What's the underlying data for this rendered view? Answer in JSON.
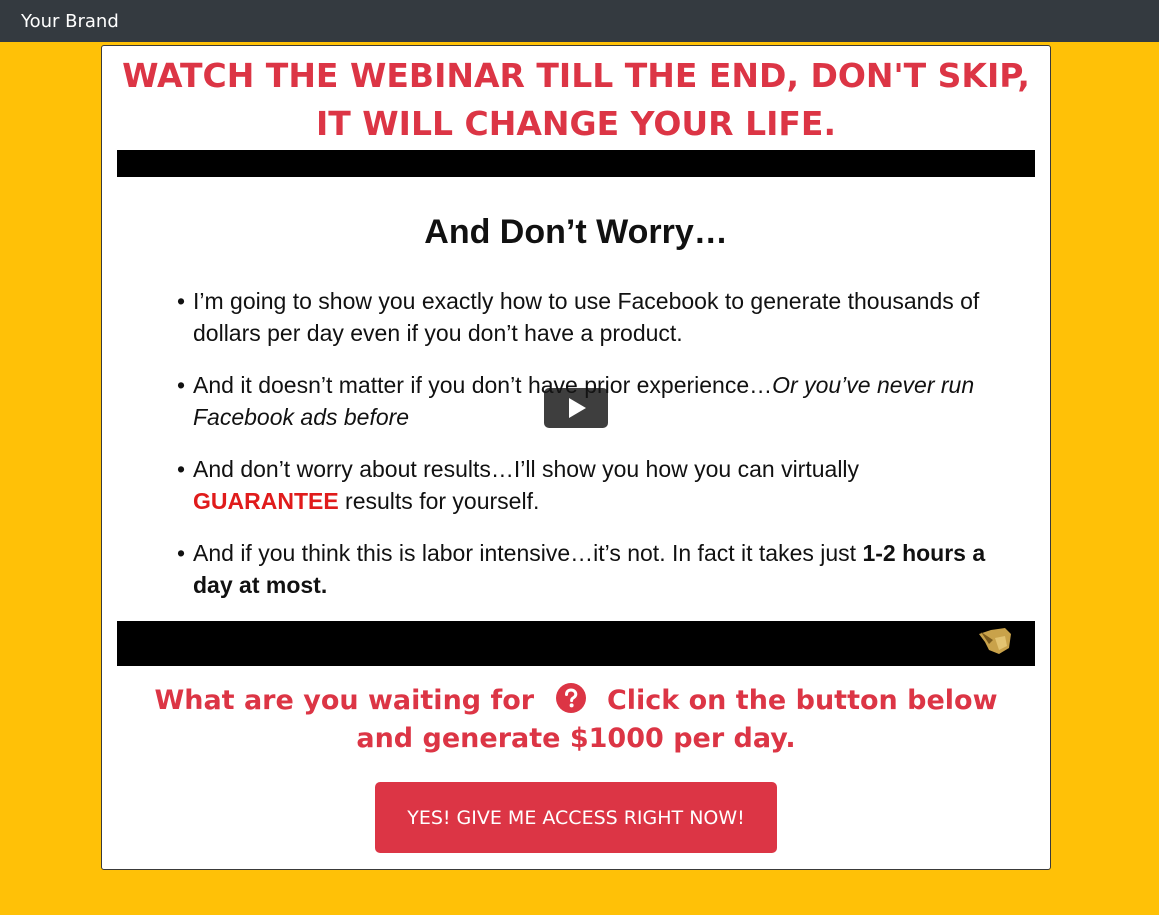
{
  "navbar": {
    "brand": "Your Brand"
  },
  "headline": "WATCH THE WEBINAR TILL THE END, DON'T SKIP, IT WILL CHANGE YOUR LIFE.",
  "video": {
    "slide_title": "And Don’t Worry…",
    "bullets": {
      "b1": "I’m going to show you exactly how to use Facebook to generate thousands of dollars per day even if you don’t have a product.",
      "b2_normal": "And it doesn’t matter if you don’t have prior experience…",
      "b2_italic": "Or you’ve never run Facebook ads before",
      "b3_start": "And don’t worry about results…I’ll show you how you can virtually ",
      "b3_highlight": "GUARANTEE",
      "b3_end": " results for yourself.",
      "b4_normal": "And if you think this is labor intensive…it’s not. In fact it takes just ",
      "b4_bold": "1-2 hours a day at most."
    },
    "icons": {
      "play": "play-icon",
      "hand": "hand-pointer-icon"
    }
  },
  "cta": {
    "text_before": "What are you waiting for",
    "text_after": "Click on the button below and generate $1000 per day.",
    "question_icon": "question-circle-icon",
    "button_label": "YES! GIVE ME ACCESS RIGHT NOW!"
  },
  "colors": {
    "background": "#ffc107",
    "navbar": "#343a40",
    "accent": "#dc3545",
    "guarantee": "#e01b1b"
  }
}
